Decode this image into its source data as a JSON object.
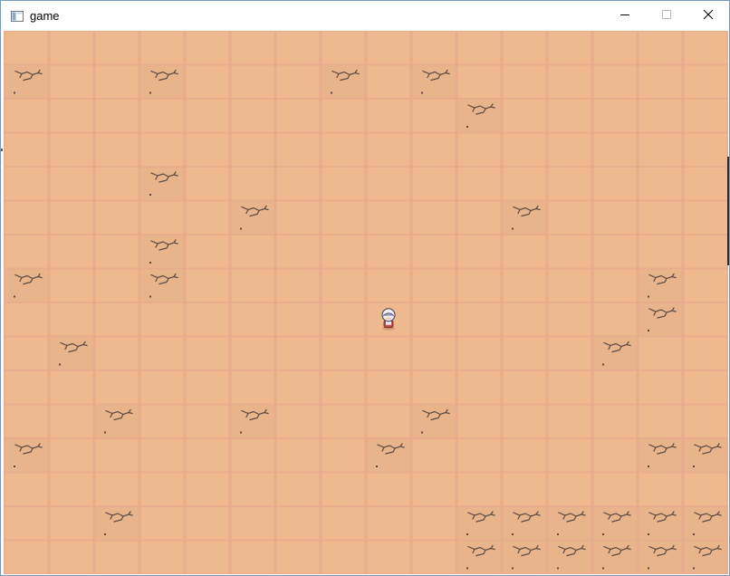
{
  "window": {
    "title": "game",
    "icon": "app-window-icon",
    "controls": {
      "minimize": "minimize-icon",
      "maximize": "maximize-icon",
      "close": "close-icon"
    }
  },
  "map": {
    "tile_columns": 16,
    "tile_rows": 16,
    "floor_color": "#efb98f",
    "grid_line_color": "#e8a98e",
    "dark_tile_color": "#e8b48c",
    "crack_color": "#5a4a44",
    "cracked_tiles": [
      [
        0,
        1
      ],
      [
        3,
        1
      ],
      [
        7,
        1
      ],
      [
        9,
        1
      ],
      [
        10,
        2
      ],
      [
        3,
        4
      ],
      [
        5,
        5
      ],
      [
        11,
        5
      ],
      [
        3,
        6
      ],
      [
        0,
        7
      ],
      [
        3,
        7
      ],
      [
        14,
        7
      ],
      [
        14,
        8
      ],
      [
        1,
        9
      ],
      [
        13,
        9
      ],
      [
        2,
        11
      ],
      [
        5,
        11
      ],
      [
        9,
        11
      ],
      [
        0,
        12
      ],
      [
        8,
        12
      ],
      [
        14,
        12
      ],
      [
        15,
        12
      ],
      [
        2,
        14
      ],
      [
        10,
        14
      ],
      [
        11,
        14
      ],
      [
        12,
        14
      ],
      [
        13,
        14
      ],
      [
        14,
        14
      ],
      [
        15,
        14
      ],
      [
        10,
        15
      ],
      [
        11,
        15
      ],
      [
        12,
        15
      ],
      [
        13,
        15
      ],
      [
        14,
        15
      ],
      [
        15,
        15
      ]
    ],
    "player": {
      "sprite": "player-character",
      "tile": [
        8,
        8
      ]
    }
  }
}
